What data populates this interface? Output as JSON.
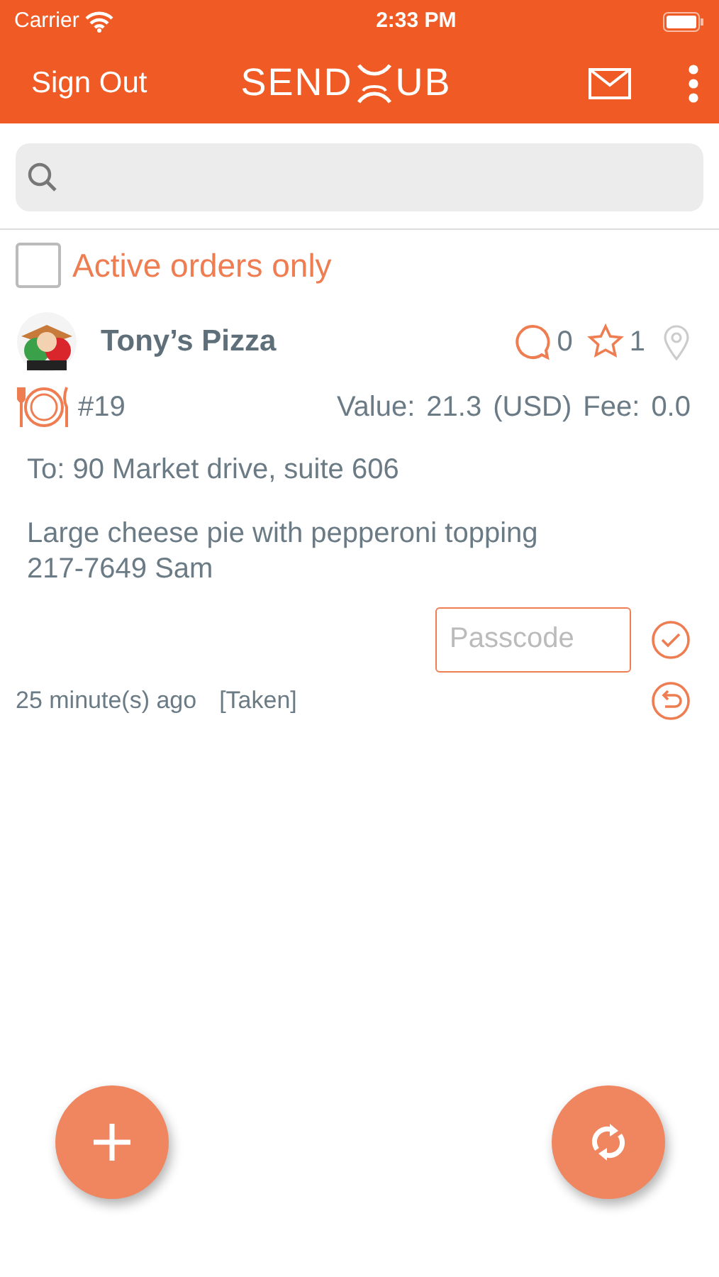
{
  "status_bar": {
    "carrier": "Carrier",
    "time": "2:33 PM"
  },
  "nav": {
    "left_button": "Sign Out",
    "logo_left": "SEND",
    "logo_right": "UB"
  },
  "filter": {
    "label": "Active orders only",
    "checked": false
  },
  "orders": [
    {
      "store": "Tony’s Pizza",
      "comments": "0",
      "stars_count": "1",
      "number": "#19",
      "value_label": "Value:",
      "value": "21.3",
      "currency": "(USD)",
      "fee_label": "Fee:",
      "fee": "0.0",
      "address": "To: 90 Market drive, suite 606",
      "details": "Large cheese pie with pepperoni topping\n217-7649 Sam",
      "passcode_placeholder": "Passcode",
      "time_ago": "25 minute(s) ago",
      "status": "[Taken]"
    }
  ]
}
